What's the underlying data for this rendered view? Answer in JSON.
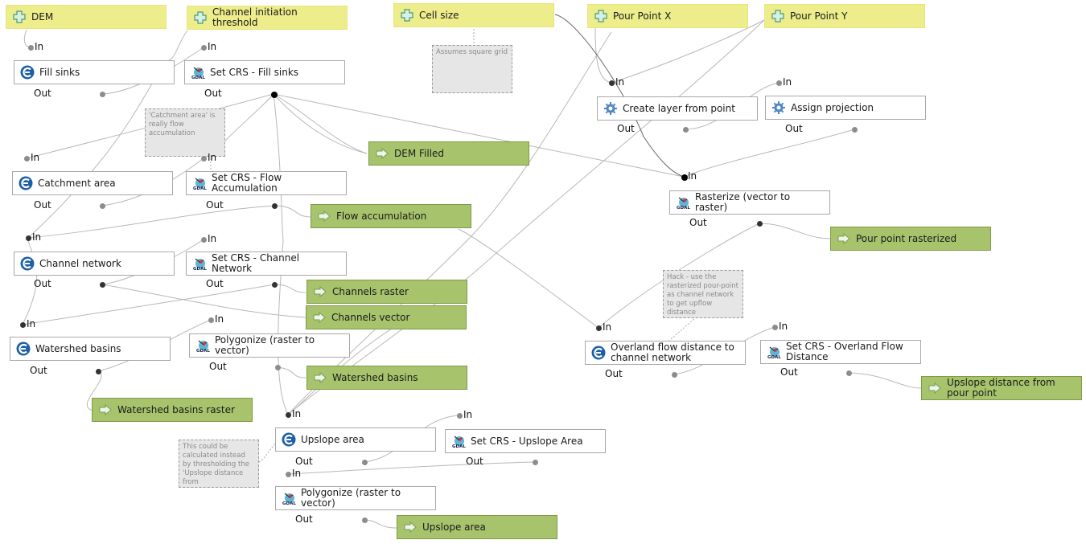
{
  "colors": {
    "input_fill": "#eded8c",
    "output_fill": "#a7c46d",
    "algorithm_fill": "#ffffff",
    "comment_fill": "#e6e6e6",
    "wire": "#b8b8b8"
  },
  "port_labels": {
    "in": "In",
    "out": "Out"
  },
  "inputs": [
    {
      "id": "dem",
      "label": "DEM",
      "icon": "plus-icon"
    },
    {
      "id": "channel-threshold",
      "label": "Channel initiation threshold",
      "icon": "plus-icon"
    },
    {
      "id": "cell-size",
      "label": "Cell size",
      "icon": "plus-icon"
    },
    {
      "id": "pour-point-x",
      "label": "Pour Point X",
      "icon": "plus-icon"
    },
    {
      "id": "pour-point-y",
      "label": "Pour Point Y",
      "icon": "plus-icon"
    }
  ],
  "algorithms": [
    {
      "id": "fill-sinks",
      "label": "Fill sinks",
      "icon": "saga-icon"
    },
    {
      "id": "setcrs-fill",
      "label": "Set CRS - Fill sinks",
      "icon": "gdal-icon"
    },
    {
      "id": "catchment",
      "label": "Catchment area",
      "icon": "saga-icon"
    },
    {
      "id": "setcrs-flow",
      "label": "Set CRS - Flow Accumulation",
      "icon": "gdal-icon"
    },
    {
      "id": "channel-network",
      "label": "Channel network",
      "icon": "saga-icon"
    },
    {
      "id": "setcrs-channel",
      "label": "Set CRS - Channel Network",
      "icon": "gdal-icon"
    },
    {
      "id": "watershed",
      "label": "Watershed basins",
      "icon": "saga-icon"
    },
    {
      "id": "polygonize-1",
      "label": "Polygonize (raster to vector)",
      "icon": "gdal-icon"
    },
    {
      "id": "upslope",
      "label": "Upslope area",
      "icon": "saga-icon"
    },
    {
      "id": "setcrs-upslope",
      "label": "Set CRS - Upslope Area",
      "icon": "gdal-icon"
    },
    {
      "id": "polygonize-2",
      "label": "Polygonize (raster to vector)",
      "icon": "gdal-icon"
    },
    {
      "id": "create-layer",
      "label": "Create layer from point",
      "icon": "gear-icon"
    },
    {
      "id": "assign-proj",
      "label": "Assign projection",
      "icon": "gear-icon"
    },
    {
      "id": "rasterize",
      "label": "Rasterize (vector to raster)",
      "icon": "gdal-icon"
    },
    {
      "id": "overland",
      "label": "Overland flow distance to channel network",
      "icon": "saga-icon"
    },
    {
      "id": "setcrs-overland",
      "label": "Set CRS - Overland Flow Distance",
      "icon": "gdal-icon"
    }
  ],
  "outputs": [
    {
      "id": "dem-filled",
      "label": "DEM Filled",
      "icon": "arrow-right-icon"
    },
    {
      "id": "flow-acc",
      "label": "Flow accumulation",
      "icon": "arrow-right-icon"
    },
    {
      "id": "channels-raster",
      "label": "Channels raster",
      "icon": "arrow-right-icon"
    },
    {
      "id": "channels-vector",
      "label": "Channels vector",
      "icon": "arrow-right-icon"
    },
    {
      "id": "watershed-basins",
      "label": "Watershed basins",
      "icon": "arrow-right-icon"
    },
    {
      "id": "watershed-raster",
      "label": "Watershed basins raster",
      "icon": "arrow-right-icon"
    },
    {
      "id": "upslope-area",
      "label": "Upslope area",
      "icon": "arrow-right-icon"
    },
    {
      "id": "pour-rasterized",
      "label": "Pour point rasterized",
      "icon": "arrow-right-icon"
    },
    {
      "id": "upslope-distance",
      "label": "Upslope distance from pour point",
      "icon": "arrow-right-icon"
    }
  ],
  "comments": [
    {
      "id": "square-grid",
      "text": "Assumes square grid"
    },
    {
      "id": "catchment-note",
      "text": "'Catchment area' is really flow accumulation"
    },
    {
      "id": "hack-note",
      "text": "Hack - use the rasterized pour-point as channel network to get upflow distance"
    },
    {
      "id": "threshold-note",
      "text": "This could be calculated instead by thresholding the 'Upslope distance from"
    }
  ]
}
